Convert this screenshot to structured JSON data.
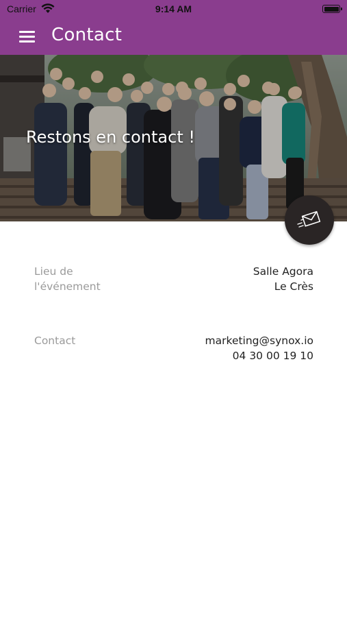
{
  "status_bar": {
    "carrier": "Carrier",
    "time": "9:14 AM"
  },
  "app_bar": {
    "title": "Contact",
    "color": "#8a3d8e"
  },
  "hero": {
    "title": "Restons en contact !"
  },
  "fab": {
    "icon": "send-mail-icon",
    "color": "#2a2525"
  },
  "info": {
    "lieu": {
      "label": "Lieu de l'événement",
      "line1": "Salle Agora",
      "line2": "Le Crès"
    },
    "contact": {
      "label": "Contact",
      "email": "marketing@synox.io",
      "phone": "04 30 00 19 10"
    }
  }
}
